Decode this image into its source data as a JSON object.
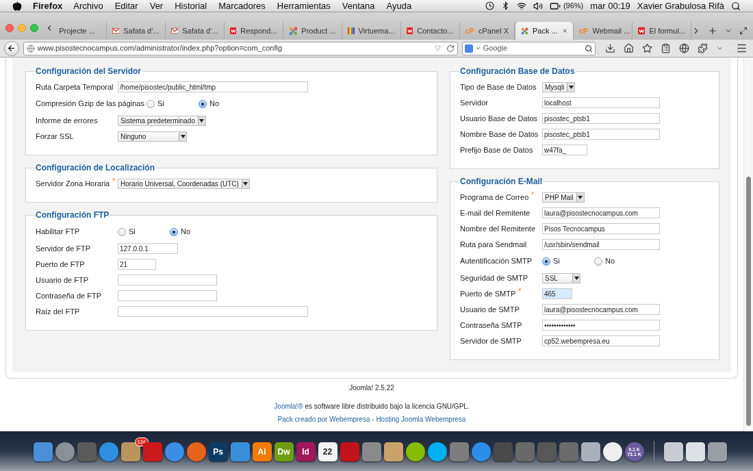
{
  "menu_bar": {
    "app": "Firefox",
    "menus": [
      "Archivo",
      "Editar",
      "Ver",
      "Historial",
      "Marcadores",
      "Herramientas",
      "Ventana",
      "Ayuda"
    ],
    "battery": "(96%)",
    "clock": "mar 00:19",
    "user": "Xavier Grabulosa Rifà"
  },
  "tabs": [
    {
      "label": "Projecte ...",
      "kind": "plain",
      "selected": false
    },
    {
      "label": "Safata d'...",
      "kind": "mail",
      "selected": false
    },
    {
      "label": "Safata d'...",
      "kind": "mail",
      "selected": false
    },
    {
      "label": "Respond...",
      "kind": "form",
      "selected": false
    },
    {
      "label": "Product ...",
      "kind": "joomla",
      "selected": false
    },
    {
      "label": "Virtuema...",
      "kind": "stripes",
      "selected": false
    },
    {
      "label": "Contacto...",
      "kind": "form",
      "selected": false
    },
    {
      "label": "cPanel X",
      "kind": "cpanel",
      "logo": "cP",
      "selected": false
    },
    {
      "label": "Pack ...",
      "kind": "joomla",
      "selected": true
    },
    {
      "label": "Webmail ...",
      "kind": "cpanel",
      "logo": "cP",
      "selected": false
    },
    {
      "label": "El formul...",
      "kind": "form",
      "selected": false
    }
  ],
  "address_bar": {
    "url": "www.pisostecnocampus.com/administrator/index.php?option=com_config"
  },
  "search_bar": {
    "placeholder": "Google"
  },
  "columns": [
    [
      {
        "title": "Configuración del Servidor",
        "rows": [
          {
            "label": "Ruta Carpeta Temporal",
            "kind": "text",
            "value": "/home/pisostec/public_html/tmp",
            "focused": false
          },
          {
            "label": "Compresión Gzip de las páginas",
            "kind": "radio",
            "options": [
              {
                "label": "Si",
                "selected": false
              },
              {
                "label": "No",
                "selected": true
              }
            ]
          },
          {
            "label": "Informe de errores",
            "kind": "select",
            "value": "Sistema predeterminado"
          },
          {
            "label": "Forzar SSL",
            "kind": "select",
            "value": "Ninguno"
          }
        ]
      },
      {
        "title": "Configuración de Localización",
        "rows": [
          {
            "label": "Servidor Zona Horaria",
            "marker": "*",
            "kind": "select",
            "value": "Horario Universal, Coordenadas (UTC)"
          }
        ]
      },
      {
        "title": "Configuración FTP",
        "rows": [
          {
            "label": "Habilitar FTP",
            "kind": "radio",
            "options": [
              {
                "label": "Si",
                "selected": false
              },
              {
                "label": "No",
                "selected": true
              }
            ]
          },
          {
            "label": "Servidor de FTP",
            "kind": "text",
            "value": "127.0.0.1",
            "focused": false
          },
          {
            "label": "Puerto de FTP",
            "kind": "text",
            "value": "21",
            "focused": false
          },
          {
            "label": "Usuario de FTP",
            "kind": "text",
            "focused": false
          },
          {
            "label": "Contraseña de FTP",
            "kind": "text",
            "focused": false
          },
          {
            "label": "Raíz del FTP",
            "kind": "text",
            "focused": false
          }
        ]
      }
    ],
    [
      {
        "title": "Configuración Base de Datos",
        "rows": [
          {
            "label": "Tipo de Base de Datos",
            "kind": "select",
            "value": "Mysqli"
          },
          {
            "label": "Servidor",
            "kind": "text",
            "value": "localhost",
            "focused": false
          },
          {
            "label": "Usuario Base de Datos",
            "kind": "text",
            "value": "pisostec_ptsb1",
            "focused": false
          },
          {
            "label": "Nombre Base de Datos",
            "kind": "text",
            "value": "pisostec_ptsb1",
            "focused": false
          },
          {
            "label": "Prefijo Base de Datos",
            "kind": "text",
            "value": "w47fa_",
            "focused": false
          }
        ]
      },
      {
        "title": "Configuración E-Mail",
        "rows": [
          {
            "label": "Programa de Correo",
            "marker": "*",
            "kind": "select",
            "value": "PHP Mail"
          },
          {
            "label": "E-mail del Remitente",
            "kind": "text",
            "value": "laura@pisostecnocampus.com",
            "focused": false
          },
          {
            "label": "Nombre del Remitente",
            "kind": "text",
            "value": "Pisos Tecnocampus",
            "focused": false
          },
          {
            "label": "Ruta para Sendmail",
            "kind": "text",
            "value": "/usr/sbin/sendmail",
            "focused": false
          },
          {
            "label": "Autentificación SMTP",
            "kind": "radio",
            "options": [
              {
                "label": "Si",
                "selected": true
              },
              {
                "label": "No",
                "selected": false
              }
            ]
          },
          {
            "label": "Seguridad de SMTP",
            "kind": "select",
            "value": "SSL"
          },
          {
            "label": "Puerto de SMTP",
            "marker": "*",
            "kind": "text",
            "value": "465",
            "focused": true
          },
          {
            "label": "Usuario de SMTP",
            "kind": "text",
            "value": "laura@pisostecnocampus.com",
            "focused": false
          },
          {
            "label": "Contraseña SMTP",
            "kind": "text",
            "value": "•••••••••••••",
            "focused": false
          },
          {
            "label": "Servidor de SMTP",
            "kind": "text",
            "value": "cp52.webempresa.eu",
            "focused": false
          }
        ]
      }
    ]
  ],
  "footer": {
    "version": "Joomla! 2.5.22",
    "lines": [
      [
        {
          "text": "Joomla!®",
          "link": true
        },
        {
          "text": " es software libre distribuido bajo la licencia GNU/GPL.",
          "link": false
        }
      ],
      [
        {
          "text": "Pack creado por Webempresa",
          "link": true
        },
        {
          "text": " - ",
          "link": false
        },
        {
          "text": "Hosting Joomla Webempresa",
          "link": true
        }
      ]
    ]
  },
  "dock": [
    {
      "kind": "tile",
      "color": "#4a8fd8"
    },
    {
      "kind": "round",
      "color": "#8a8f98"
    },
    {
      "kind": "tile",
      "color": "#5b5b5b"
    },
    {
      "kind": "round",
      "color": "#2f8fe0"
    },
    {
      "kind": "tile",
      "color": "#b9955c",
      "badge": "124"
    },
    {
      "kind": "tile",
      "color": "#cc1a1a"
    },
    {
      "kind": "round",
      "color": "#3a8ee6"
    },
    {
      "kind": "round",
      "color": "#e8631a"
    },
    {
      "kind": "tile",
      "color": "#0d3b66",
      "label": "Ps"
    },
    {
      "kind": "tile",
      "color": "#3a90d8"
    },
    {
      "kind": "tile",
      "color": "#f07b00",
      "label": "Ai"
    },
    {
      "kind": "tile",
      "color": "#6f9e12",
      "label": "Dw"
    },
    {
      "kind": "tile",
      "color": "#a0185a",
      "label": "Id"
    },
    {
      "kind": "tile",
      "color": "#f2f2f2",
      "label": "22"
    },
    {
      "kind": "tile",
      "color": "#c0141a"
    },
    {
      "kind": "tile",
      "color": "#8a8a8a"
    },
    {
      "kind": "tile",
      "color": "#c9a26a"
    },
    {
      "kind": "round",
      "color": "#84bd00"
    },
    {
      "kind": "round",
      "color": "#00aff0"
    },
    {
      "kind": "tile",
      "color": "#7d7d7d"
    },
    {
      "kind": "round",
      "color": "#2b8ee8"
    },
    {
      "kind": "tile",
      "color": "#4a4a4a"
    },
    {
      "kind": "tile",
      "color": "#686868"
    },
    {
      "kind": "tile",
      "color": "#575757"
    },
    {
      "kind": "tile",
      "color": "#6a6a6a"
    },
    {
      "kind": "tile",
      "color": "#a9b0bb"
    },
    {
      "kind": "round",
      "color": "#eeeeee"
    },
    {
      "kind": "round",
      "color": "#6a5aa0",
      "label": "0.1 K",
      "sublabel": "73.1 K"
    },
    {
      "kind": "separator"
    },
    {
      "kind": "tile",
      "color": "#c8ccd2"
    },
    {
      "kind": "tile",
      "color": "#dde0e4"
    },
    {
      "kind": "tile",
      "color": "#9a9ea4"
    }
  ]
}
